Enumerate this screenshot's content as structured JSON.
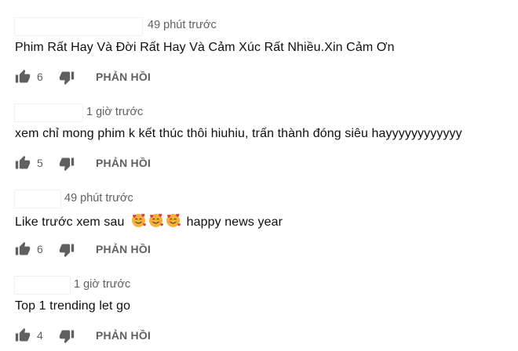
{
  "comments": [
    {
      "time": "49 phút trước",
      "text": "Phim Rất Hay Và Đời Rất Hay Và Cảm Xúc Rất Nhiều.Xin Cảm Ơn",
      "likes": "6",
      "reply_label": "PHẢN HỒI"
    },
    {
      "time": "1 giờ trước",
      "text": "xem chỉ mong phim k kết thúc thôi hiuhiu, trấn thành đóng siêu hayyyyyyyyyyyy",
      "likes": "5",
      "reply_label": "PHẢN HỒI"
    },
    {
      "time": "49 phút trước",
      "text_before": "Like trước xem sau",
      "emoji_name": "smiling-face-with-hearts-emoji",
      "emoji_count": 3,
      "text_after": "happy news year",
      "likes": "6",
      "reply_label": "PHẢN HỒI"
    },
    {
      "time": "1 giờ trước",
      "text": "Top 1 trending let go",
      "likes": "4",
      "reply_label": "PHẢN HỒI"
    }
  ],
  "icons": {
    "like": "thumbs-up-icon",
    "dislike": "thumbs-down-icon"
  },
  "colors": {
    "meta_text": "#606060",
    "comment_text": "#0f0f0f",
    "icon": "#606060",
    "emoji_face": "#f5b335",
    "emoji_heart": "#e2343f"
  }
}
